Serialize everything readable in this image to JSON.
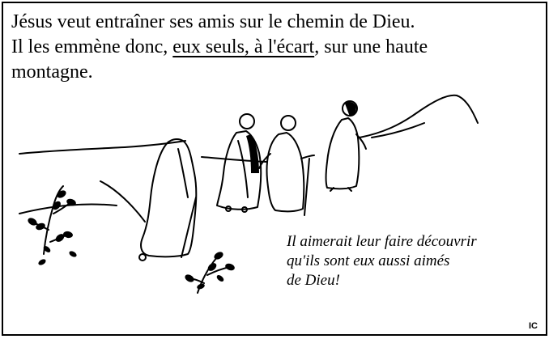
{
  "caption": {
    "line1": "Jésus veut entraîner ses amis sur le chemin de Dieu.",
    "line2_before": "Il les emmène donc, ",
    "line2_underlined": "eux seuls, à l'écart",
    "line2_after": ", sur une haute",
    "line3": "montagne."
  },
  "quote": {
    "line1": "Il aimerait leur faire découvrir",
    "line2": "qu'ils sont eux aussi aimés",
    "line3": "de Dieu!"
  },
  "signature": "IC",
  "illustration": {
    "subject": "four-walking-figures-on-mountain-path",
    "style": "black-line-drawing"
  }
}
